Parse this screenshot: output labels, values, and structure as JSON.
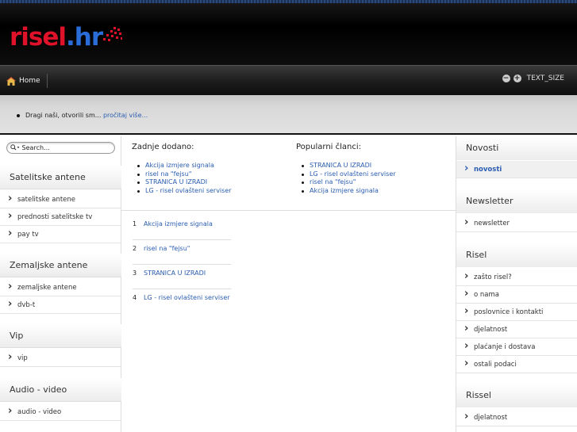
{
  "logo": {
    "part1": "risel",
    "part2": ".hr"
  },
  "nav": {
    "home": "Home",
    "textsize": "TEXT_SIZE",
    "minus": "−",
    "plus": "+"
  },
  "ticker": {
    "text": "Dragi naši, otvorili sm...",
    "link": "pročitaj više..."
  },
  "search": {
    "placeholder": "Search..."
  },
  "left": {
    "sections": [
      {
        "title": "Satelitske antene",
        "links": [
          "satelitske antene",
          "prednosti satelitske tv",
          "pay tv"
        ]
      },
      {
        "title": "Zemaljske antene",
        "links": [
          "zemaljske antene",
          "dvb-t"
        ]
      },
      {
        "title": "Vip",
        "links": [
          "vip"
        ]
      },
      {
        "title": "Audio - video",
        "links": [
          "audio - video"
        ]
      }
    ]
  },
  "main": {
    "latest_title": "Zadnje dodano:",
    "latest": [
      "Akcija izmjere signala",
      "risel na \"fejsu\"",
      "STRANICA U IZRADI",
      "LG - risel ovlašteni serviser"
    ],
    "popular_title": "Popularni članci:",
    "popular": [
      "STRANICA U IZRADI",
      "LG - risel ovlašteni serviser",
      "risel na \"fejsu\"",
      "Akcija izmjere signala"
    ],
    "numbered": [
      {
        "n": "1",
        "t": "Akcija izmjere signala"
      },
      {
        "n": "2",
        "t": "risel na \"fejsu\""
      },
      {
        "n": "3",
        "t": "STRANICA U IZRADI"
      },
      {
        "n": "4",
        "t": "LG - risel ovlašteni serviser"
      }
    ]
  },
  "right": {
    "sections": [
      {
        "title": "Novosti",
        "links": [
          "novosti"
        ]
      },
      {
        "title": "Newsletter",
        "links": [
          "newsletter"
        ]
      },
      {
        "title": "Risel",
        "links": [
          "zašto risel?",
          "o nama",
          "poslovnice i kontakti",
          "djelatnost",
          "plaćanje i dostava",
          "ostali podaci"
        ]
      },
      {
        "title": "Rissel",
        "links": [
          "djelatnost"
        ]
      }
    ]
  },
  "colors": {
    "brand_red": "#e0122a",
    "brand_blue": "#2a6dd9",
    "link": "#2a5db0"
  }
}
